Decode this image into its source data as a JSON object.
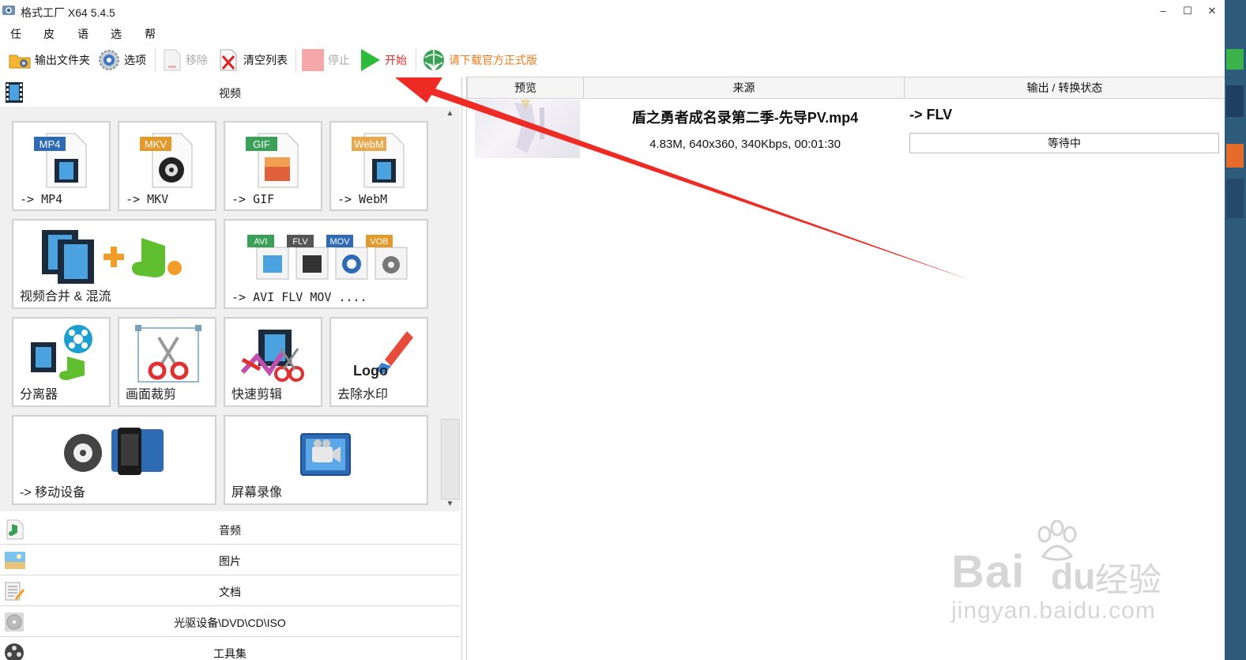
{
  "window": {
    "title": "格式工厂 X64 5.4.5",
    "minimize": "–",
    "maximize": "☐",
    "close": "✕"
  },
  "menu": [
    "任务",
    "皮肤",
    "语言",
    "选项",
    "帮助"
  ],
  "toolbar": {
    "output_folder": "输出文件夹",
    "options": "选项",
    "remove": "移除",
    "clear_list": "清空列表",
    "stop": "停止",
    "start": "开始",
    "download_official": "请下载官方正式版"
  },
  "categories": {
    "video": "视频",
    "audio": "音频",
    "picture": "图片",
    "document": "文档",
    "disc": "光驱设备\\DVD\\CD\\ISO",
    "tools": "工具集"
  },
  "tiles": {
    "mp4": {
      "badge": "MP4",
      "label": "-> MP4"
    },
    "mkv": {
      "badge": "MKV",
      "label": "-> MKV"
    },
    "gif": {
      "badge": "GIF",
      "label": "-> GIF"
    },
    "webm": {
      "badge": "WebM",
      "label": "-> WebM"
    },
    "merge": {
      "label": "视频合并 & 混流"
    },
    "multi": {
      "badges": [
        "AVI",
        "FLV",
        "MOV",
        "VOB"
      ],
      "label": "-> AVI FLV MOV ...."
    },
    "splitter": {
      "label": "分离器"
    },
    "crop": {
      "label": "画面裁剪"
    },
    "quick_clip": {
      "label": "快速剪辑"
    },
    "remove_watermark": {
      "label": "去除水印",
      "logo_text": "Logo"
    },
    "mobile": {
      "label": "-> 移动设备"
    },
    "screen_record": {
      "label": "屏幕录像"
    }
  },
  "table": {
    "headers": [
      "预览",
      "来源",
      "输出 / 转换状态"
    ],
    "rows": [
      {
        "filename": "盾之勇者成名录第二季-先导PV.mp4",
        "info": "4.83M, 640x360, 340Kbps, 00:01:30",
        "target": "-> FLV",
        "status": "等待中"
      }
    ]
  },
  "watermark": {
    "brand": "Bai",
    "brand2": "du",
    "cn": "经验",
    "url": "jingyan.baidu.com"
  },
  "colors": {
    "accent_red": "#ee2b24",
    "start_green": "#2dbb3a",
    "badge_blue": "#2f6bb5"
  }
}
